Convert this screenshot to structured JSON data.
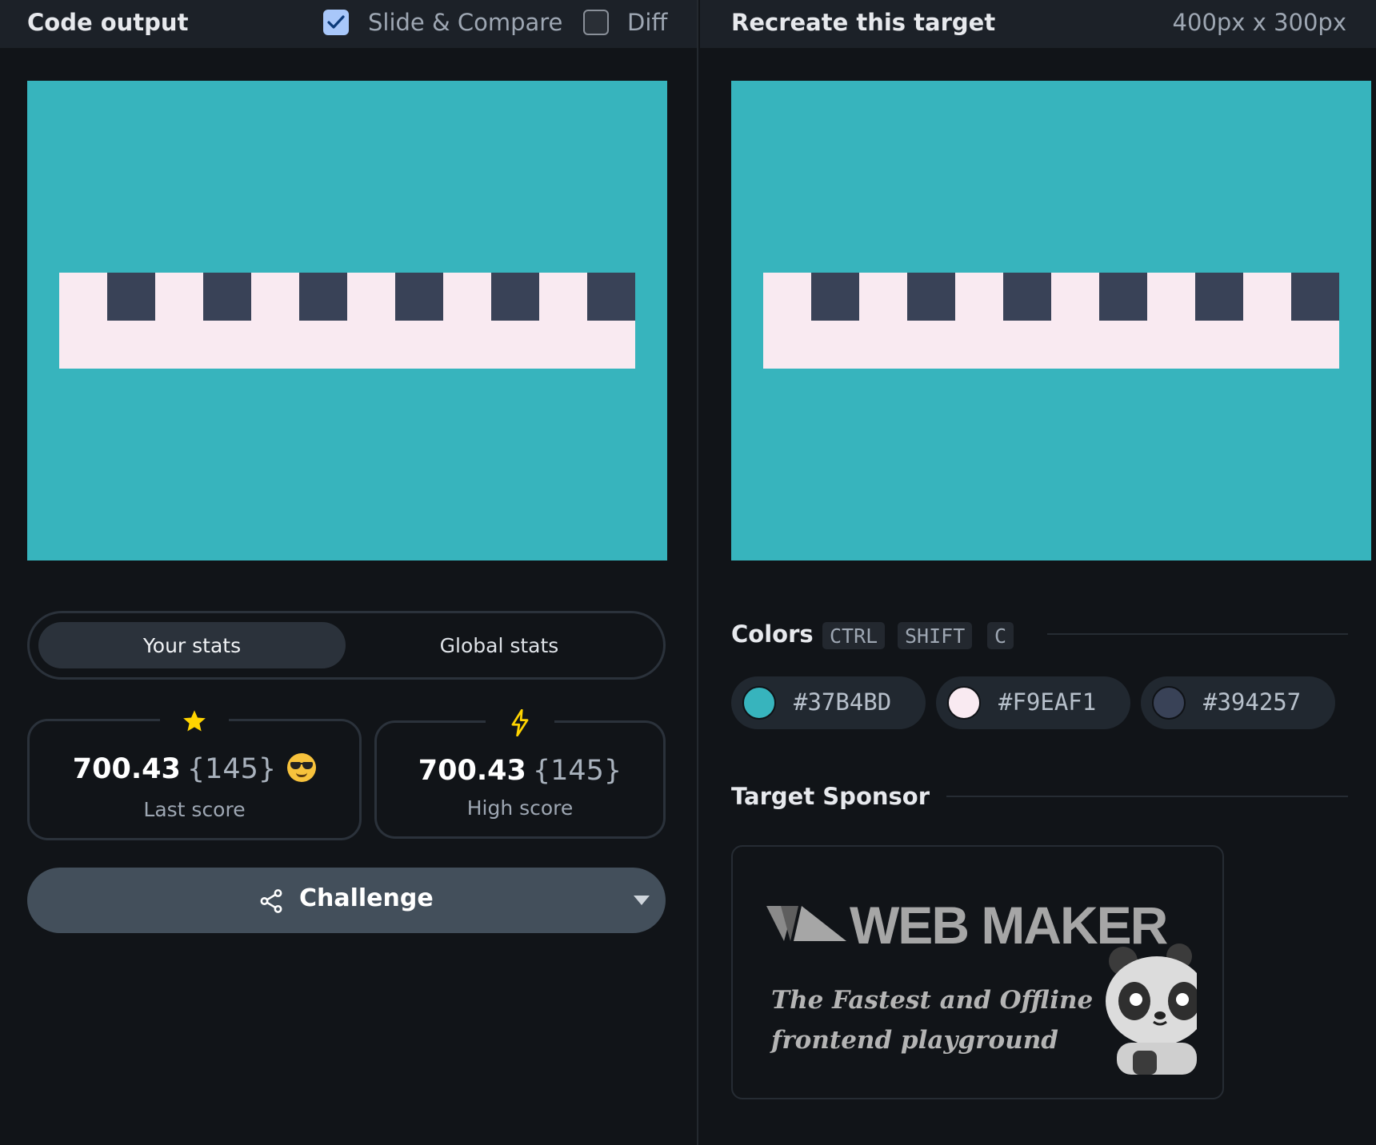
{
  "left": {
    "title": "Code output",
    "slide_compare": {
      "label": "Slide & Compare",
      "checked": true
    },
    "diff": {
      "label": "Diff",
      "checked": false
    }
  },
  "right": {
    "title": "Recreate this target",
    "dimensions": "400px x 300px"
  },
  "stats": {
    "tabs": [
      {
        "label": "Your stats",
        "active": true
      },
      {
        "label": "Global stats",
        "active": false
      }
    ],
    "last": {
      "score": "700.43",
      "count": "{145}",
      "label": "Last score",
      "icon": "star-icon",
      "icon_color": "#FFD400"
    },
    "high": {
      "score": "700.43",
      "count": "{145}",
      "label": "High score",
      "icon": "lightning-icon",
      "icon_color": "#FFD400"
    }
  },
  "challenge": {
    "label": "Challenge"
  },
  "colors": {
    "title": "Colors",
    "shortcut": [
      "CTRL",
      "SHIFT",
      "C"
    ],
    "swatches": [
      {
        "hex": "#37B4BD"
      },
      {
        "hex": "#F9EAF1"
      },
      {
        "hex": "#394257"
      }
    ]
  },
  "sponsor": {
    "title": "Target Sponsor",
    "brand": "WEB MAKER",
    "tagline_1": "The Fastest and Offline",
    "tagline_2": "frontend playground"
  },
  "target_palette": {
    "background": "#37B4BD",
    "bar": "#F9EAF1",
    "squares": "#394257"
  }
}
